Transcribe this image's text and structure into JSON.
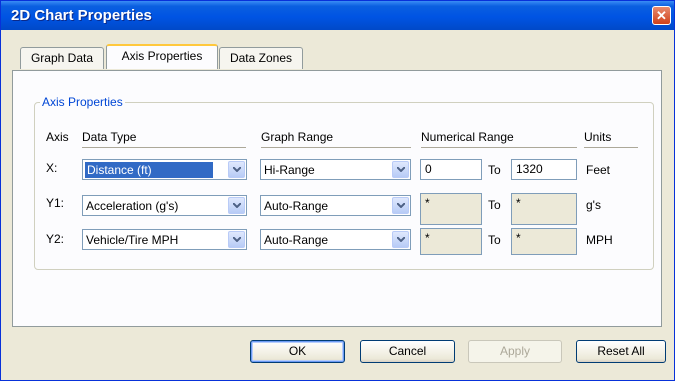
{
  "window": {
    "title": "2D Chart Properties",
    "close_symbol": "✕"
  },
  "tabs": [
    {
      "label": "Graph Data",
      "active": false
    },
    {
      "label": "Axis Properties",
      "active": true
    },
    {
      "label": "Data Zones",
      "active": false
    }
  ],
  "group": {
    "title": "Axis Properties"
  },
  "headers": {
    "axis": "Axis",
    "data_type": "Data Type",
    "graph_range": "Graph Range",
    "numerical_range": "Numerical Range",
    "units": "Units"
  },
  "rows": [
    {
      "axis": "X:",
      "data_type": "Distance (ft)",
      "graph_range": "Hi-Range",
      "from": "0",
      "to_label": "To",
      "to": "1320",
      "unit": "Feet"
    },
    {
      "axis": "Y1:",
      "data_type": "Acceleration (g's)",
      "graph_range": "Auto-Range",
      "from": "*",
      "to_label": "To",
      "to": "*",
      "unit": "g's"
    },
    {
      "axis": "Y2:",
      "data_type": "Vehicle/Tire MPH",
      "graph_range": "Auto-Range",
      "from": "*",
      "to_label": "To",
      "to": "*",
      "unit": "MPH"
    }
  ],
  "buttons": {
    "ok": "OK",
    "cancel": "Cancel",
    "apply": "Apply",
    "reset_all": "Reset All"
  },
  "colors": {
    "titlebar": "#0054e3",
    "selection": "#316ac5",
    "group_title": "#0046d5",
    "active_tab_accent": "#ffc83c"
  }
}
